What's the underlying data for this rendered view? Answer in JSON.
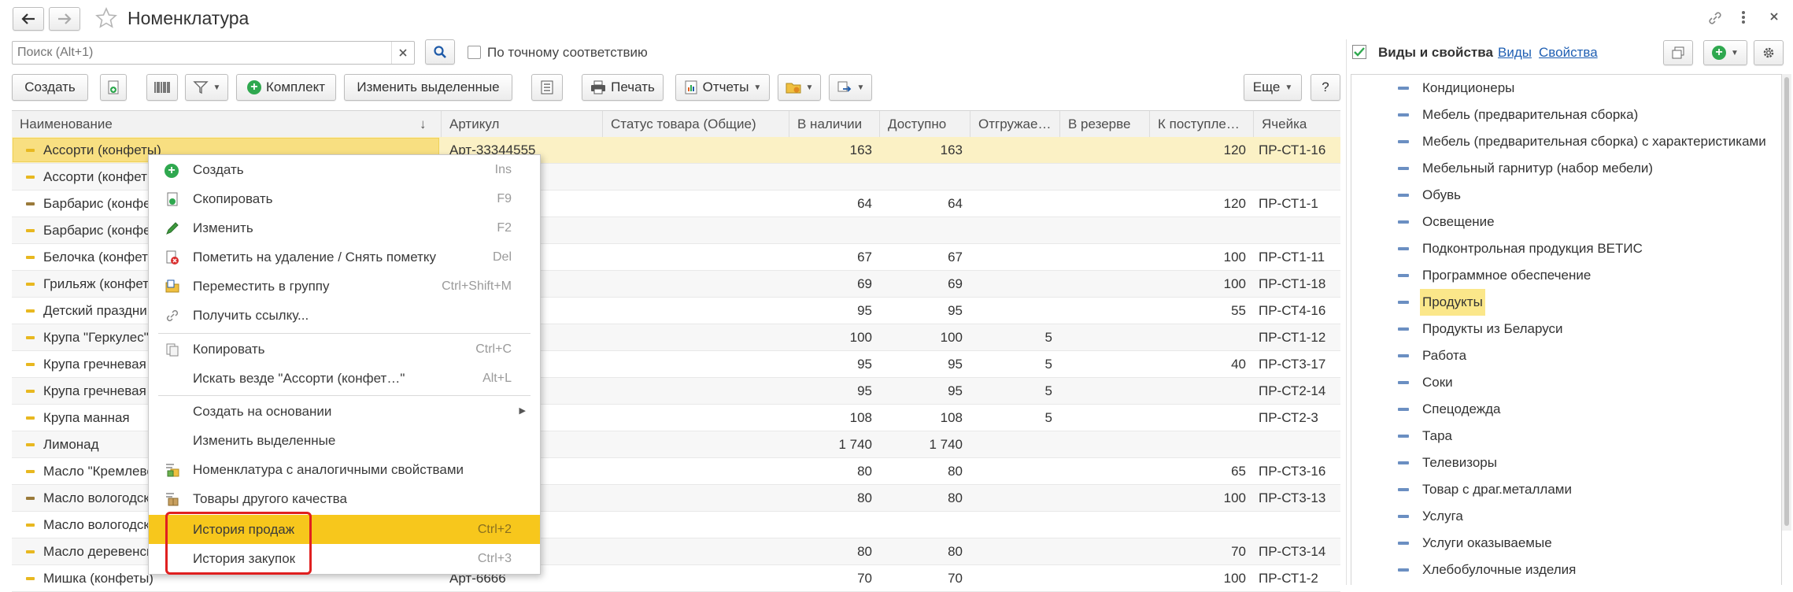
{
  "window": {
    "title": "Номенклатура"
  },
  "search": {
    "placeholder": "Поиск (Alt+1)",
    "exact_match_label": "По точному соответствию"
  },
  "toolbar": {
    "create": "Создать",
    "kit": "Комплект",
    "edit_selected": "Изменить выделенные",
    "print": "Печать",
    "reports": "Отчеты",
    "more": "Еще",
    "help": "?"
  },
  "table": {
    "columns": [
      "Наименование",
      "Артикул",
      "Статус товара (Общие)",
      "В наличии",
      "Доступно",
      "Отгружае…",
      "В резерве",
      "К поступле…",
      "Ячейка"
    ],
    "sort_indicator": "↓",
    "rows": [
      {
        "name": "Ассорти (конфеты)",
        "article": "Арт-33344555",
        "status": "",
        "stock": "163",
        "available": "163",
        "shipped": "",
        "reserved": "",
        "incoming": "120",
        "cell": "ПР-СТ1-16",
        "marker": "yellow"
      },
      {
        "name": "Ассорти (конфеты",
        "article": "",
        "status": "",
        "stock": "",
        "available": "",
        "shipped": "",
        "reserved": "",
        "incoming": "",
        "cell": "",
        "marker": "yellow"
      },
      {
        "name": "Барбарис (конфе",
        "article": "",
        "status": "",
        "stock": "64",
        "available": "64",
        "shipped": "",
        "reserved": "",
        "incoming": "120",
        "cell": "ПР-СТ1-1",
        "marker": "brown"
      },
      {
        "name": "Барбарис (конфе",
        "article": "",
        "status": "",
        "stock": "",
        "available": "",
        "shipped": "",
        "reserved": "",
        "incoming": "",
        "cell": "",
        "marker": "yellow"
      },
      {
        "name": "Белочка (конфет",
        "article": "",
        "status": "",
        "stock": "67",
        "available": "67",
        "shipped": "",
        "reserved": "",
        "incoming": "100",
        "cell": "ПР-СТ1-11",
        "marker": "yellow"
      },
      {
        "name": "Грильяж (конфет",
        "article": "",
        "status": "",
        "stock": "69",
        "available": "69",
        "shipped": "",
        "reserved": "",
        "incoming": "100",
        "cell": "ПР-СТ1-18",
        "marker": "yellow"
      },
      {
        "name": "Детский праздни",
        "article": "",
        "status": "",
        "stock": "95",
        "available": "95",
        "shipped": "",
        "reserved": "",
        "incoming": "55",
        "cell": "ПР-СТ4-16",
        "marker": "yellow"
      },
      {
        "name": "Крупа \"Геркулес\"",
        "article": "",
        "status": "",
        "stock": "100",
        "available": "100",
        "shipped": "5",
        "reserved": "",
        "incoming": "",
        "cell": "ПР-СТ1-12",
        "marker": "yellow"
      },
      {
        "name": "Крупа гречневая",
        "article": "",
        "status": "",
        "stock": "95",
        "available": "95",
        "shipped": "5",
        "reserved": "",
        "incoming": "40",
        "cell": "ПР-СТ3-17",
        "marker": "yellow"
      },
      {
        "name": "Крупа гречневая",
        "article": "",
        "status": "",
        "stock": "95",
        "available": "95",
        "shipped": "5",
        "reserved": "",
        "incoming": "",
        "cell": "ПР-СТ2-14",
        "marker": "yellow"
      },
      {
        "name": "Крупа манная",
        "article": "",
        "status": "",
        "stock": "108",
        "available": "108",
        "shipped": "5",
        "reserved": "",
        "incoming": "",
        "cell": "ПР-СТ2-3",
        "marker": "yellow"
      },
      {
        "name": "Лимонад",
        "article": "",
        "status": "",
        "stock": "1 740",
        "available": "1 740",
        "shipped": "",
        "reserved": "",
        "incoming": "",
        "cell": "",
        "marker": "yellow"
      },
      {
        "name": "Масло \"Кремлево",
        "article": "",
        "status": "",
        "stock": "80",
        "available": "80",
        "shipped": "",
        "reserved": "",
        "incoming": "65",
        "cell": "ПР-СТ3-16",
        "marker": "yellow"
      },
      {
        "name": "Масло вологодск",
        "article": "",
        "status": "",
        "stock": "80",
        "available": "80",
        "shipped": "",
        "reserved": "",
        "incoming": "100",
        "cell": "ПР-СТ3-13",
        "marker": "brown"
      },
      {
        "name": "Масло вологодск",
        "article": "",
        "status": "",
        "stock": "",
        "available": "",
        "shipped": "",
        "reserved": "",
        "incoming": "",
        "cell": "",
        "marker": "yellow"
      },
      {
        "name": "Масло деревенск",
        "article": "",
        "status": "",
        "stock": "80",
        "available": "80",
        "shipped": "",
        "reserved": "",
        "incoming": "70",
        "cell": "ПР-СТ3-14",
        "marker": "yellow"
      },
      {
        "name": "Мишка (конфеты)",
        "article": "Арт-6666",
        "status": "",
        "stock": "70",
        "available": "70",
        "shipped": "",
        "reserved": "",
        "incoming": "100",
        "cell": "ПР-СТ1-2",
        "marker": "yellow"
      }
    ]
  },
  "context_menu": {
    "items": [
      {
        "label": "Создать",
        "shortcut": "Ins",
        "icon": "green-plus-icon"
      },
      {
        "label": "Скопировать",
        "shortcut": "F9",
        "icon": "copy-doc-icon"
      },
      {
        "label": "Изменить",
        "shortcut": "F2",
        "icon": "pencil-icon"
      },
      {
        "label": "Пометить на удаление / Снять пометку",
        "shortcut": "Del",
        "icon": "delete-mark-icon"
      },
      {
        "label": "Переместить в группу",
        "shortcut": "Ctrl+Shift+M",
        "icon": "move-to-group-icon"
      },
      {
        "label": "Получить ссылку...",
        "shortcut": "",
        "icon": "link-icon"
      },
      {
        "label": "Копировать",
        "shortcut": "Ctrl+C",
        "icon": "clipboard-copy-icon"
      },
      {
        "label": "Искать везде \"Ассорти (конфет…\"",
        "shortcut": "Alt+L",
        "icon": ""
      },
      {
        "label": "Создать на основании",
        "shortcut": "",
        "icon": "",
        "submenu": "▶"
      },
      {
        "label": "Изменить выделенные",
        "shortcut": "",
        "icon": ""
      },
      {
        "label": "Номенклатура с аналогичными свойствами",
        "shortcut": "",
        "icon": "similar-properties-icon"
      },
      {
        "label": "Товары другого качества",
        "shortcut": "",
        "icon": "other-quality-icon"
      },
      {
        "label": "История продаж",
        "shortcut": "Ctrl+2",
        "icon": ""
      },
      {
        "label": "История закупок",
        "shortcut": "Ctrl+3",
        "icon": ""
      }
    ],
    "highlight_color": "#f7c71c",
    "callout_color": "#e02020"
  },
  "right_panel": {
    "checkbox_label": "Виды и свойства",
    "link_kinds": "Виды",
    "link_properties": "Свойства",
    "items": [
      "Кондиционеры",
      "Мебель (предварительная сборка)",
      "Мебель (предварительная сборка) с характеристиками",
      "Мебельный гарнитур (набор мебели)",
      "Обувь",
      "Освещение",
      "Подконтрольная продукция ВЕТИС",
      "Программное обеспечение",
      "Продукты",
      "Продукты из Беларуси",
      "Работа",
      "Соки",
      "Спецодежда",
      "Тара",
      "Телевизоры",
      "Товар с драг.металлами",
      "Услуга",
      "Услуги оказываемые",
      "Хлебобулочные изделия"
    ],
    "selected_item": "Продукты"
  },
  "colors": {
    "selected_row": "#fbf1c5",
    "accent_yellow": "#f7c71c",
    "link_blue": "#1f5fb3",
    "group_marker": "#6b8fc2"
  }
}
